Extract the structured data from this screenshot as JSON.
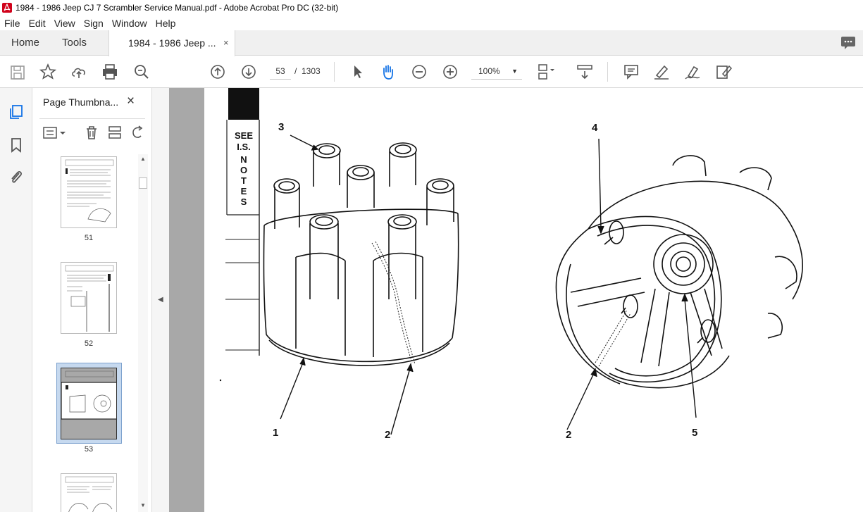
{
  "window": {
    "title": "1984 - 1986 Jeep CJ 7 Scrambler Service Manual.pdf - Adobe Acrobat Pro DC (32-bit)"
  },
  "menu": [
    "File",
    "Edit",
    "View",
    "Sign",
    "Window",
    "Help"
  ],
  "tabs": {
    "home": "Home",
    "tools": "Tools",
    "document": "1984 - 1986 Jeep ...",
    "close": "×"
  },
  "toolbar": {
    "current_page": "53",
    "page_separator": "/",
    "total_pages": "1303",
    "zoom": "100%"
  },
  "thumbnails": {
    "panel_title": "Page Thumbna...",
    "close": "×",
    "pages": [
      "51",
      "52",
      "53",
      ""
    ],
    "selected": "53"
  },
  "document": {
    "side_note": [
      "SEE",
      "I.S.",
      "N",
      "O",
      "T",
      "E",
      "S"
    ],
    "callouts_left": [
      "3",
      "1",
      "2"
    ],
    "callouts_right": [
      "4",
      "2",
      "5"
    ]
  },
  "colors": {
    "accent": "#1473e6",
    "app_red": "#d0021b",
    "page_bg": "#a8a8a8",
    "selection": "#c6d9ef"
  }
}
